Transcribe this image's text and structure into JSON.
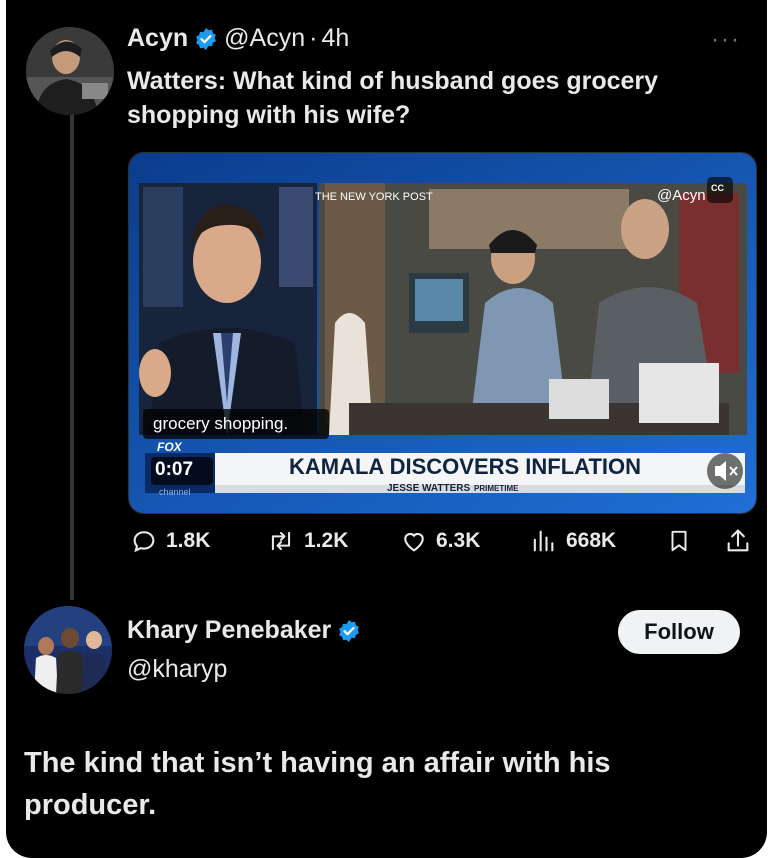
{
  "tweet": {
    "author_name": "Acyn",
    "author_handle": "@Acyn",
    "separator": "·",
    "time": "4h",
    "more": "···",
    "text": "Watters: What kind of husband goes grocery shopping with his wife?"
  },
  "video": {
    "source_tag": "THE NEW YORK POST",
    "watermark": "@Acyn",
    "cc_label": "CC",
    "caption": "grocery shopping.",
    "timestamp": "0:07",
    "network_logo": "FOX",
    "network_logo_sub": "channel",
    "headline": "KAMALA DISCOVERS INFLATION",
    "show_name": "JESSE WATTERS",
    "show_suffix": "PRIMETIME"
  },
  "actions": {
    "replies": "1.8K",
    "reposts": "1.2K",
    "likes": "6.3K",
    "views": "668K"
  },
  "reply": {
    "author_name": "Khary Penebaker",
    "author_handle": "@kharyp",
    "follow_label": "Follow",
    "text": "The kind that isn’t having an affair with his producer."
  },
  "colors": {
    "background": "#000000",
    "text": "#e7e9ea",
    "verified": "#1d9bf0",
    "follow_bg": "#eff3f4"
  },
  "icons": [
    "verified-icon",
    "more-icon",
    "reply-icon",
    "repost-icon",
    "like-icon",
    "views-icon",
    "bookmark-icon",
    "share-icon",
    "mute-icon"
  ]
}
